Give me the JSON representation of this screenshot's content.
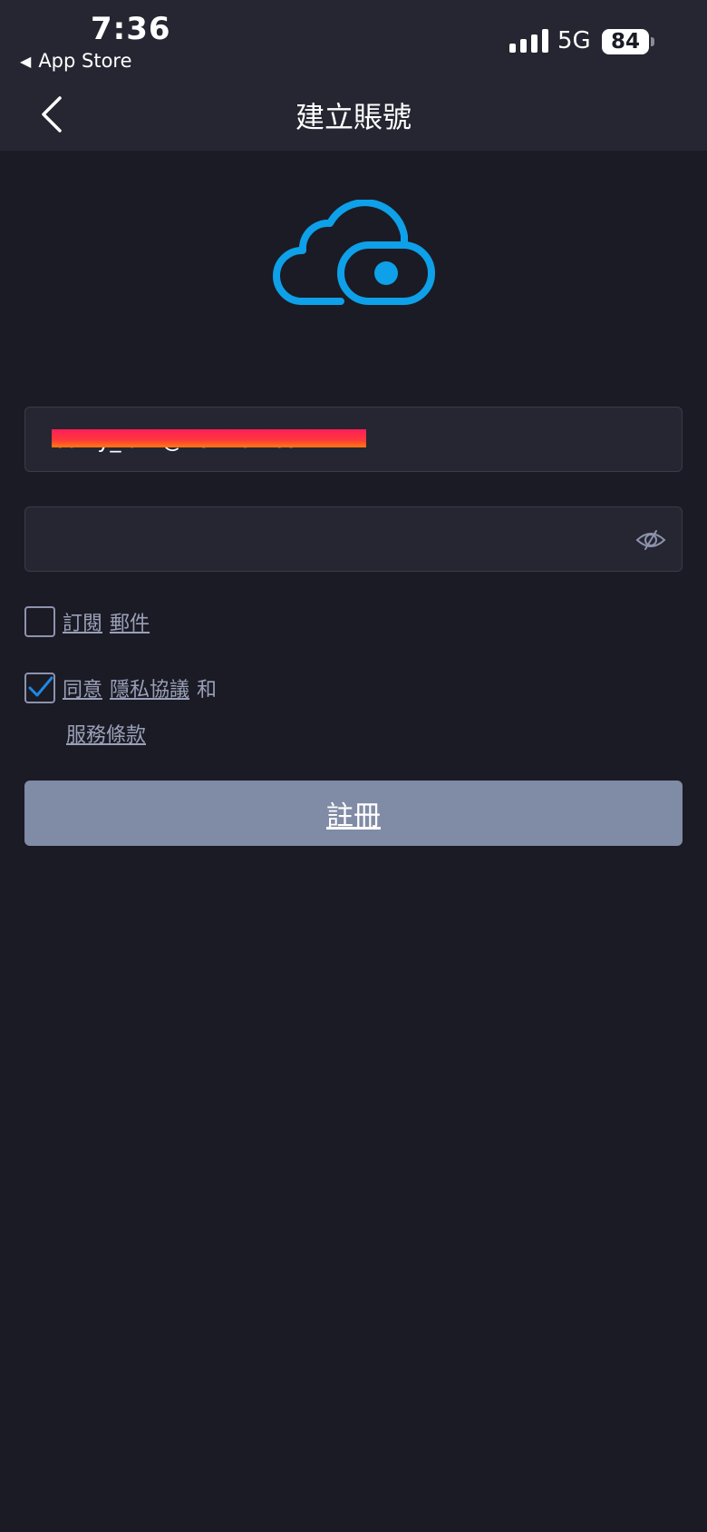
{
  "status_bar": {
    "time": "7:36",
    "back_app": "App Store",
    "network": "5G",
    "battery": "84"
  },
  "nav": {
    "title": "建立賬號"
  },
  "form": {
    "email_value": "barry_lam@hotmail.com",
    "password_value": "",
    "subscribe": {
      "label": "訂閱",
      "link": "郵件",
      "checked": false
    },
    "agree": {
      "label": "同意",
      "privacy_link": "隱私協議",
      "and": "和",
      "terms_link": "服務條款",
      "checked": true
    },
    "register_label": "註冊"
  },
  "colors": {
    "accent": "#0ea0e8",
    "background": "#1b1b25",
    "header": "#252631",
    "button": "#808ba5",
    "check": "#1e88e5"
  },
  "icons": {
    "logo": "cloud-eye-logo",
    "back": "chevron-left-icon",
    "eye": "eye-slash-icon",
    "check": "checkmark-icon"
  }
}
